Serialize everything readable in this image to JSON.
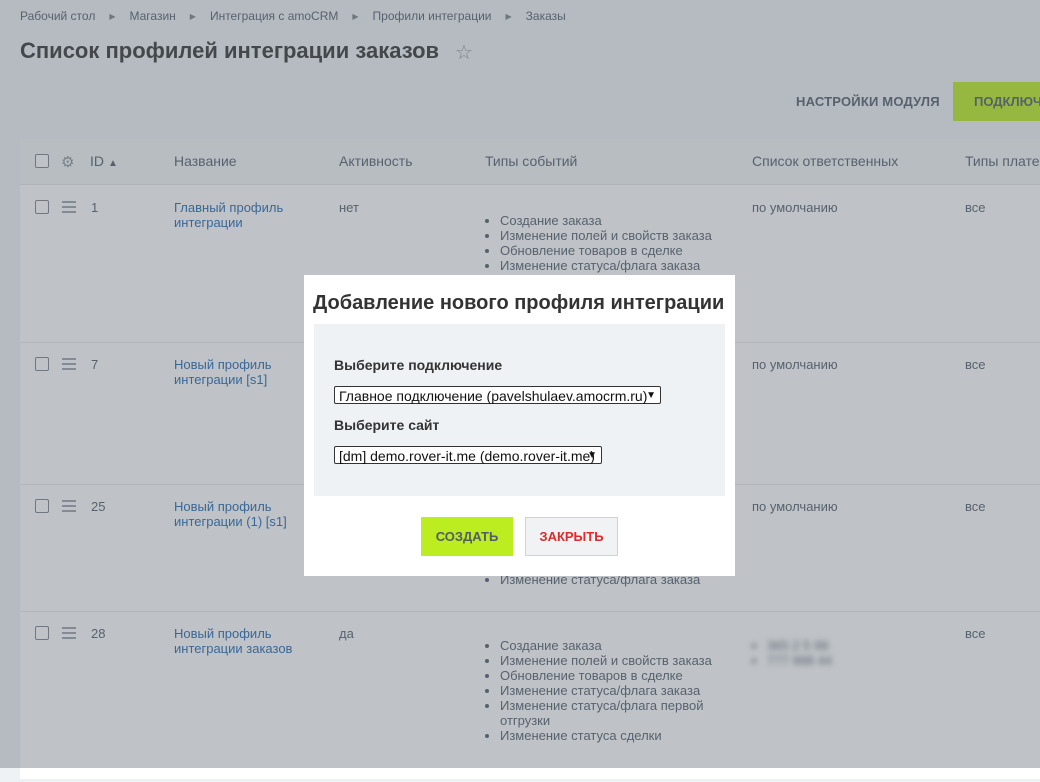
{
  "breadcrumb": [
    "Рабочий стол",
    "Магазин",
    "Интеграция с amoCRM",
    "Профили интеграции",
    "Заказы"
  ],
  "page_title": "Список профилей интеграции заказов",
  "toolbar": {
    "settings_label": "НАСТРОЙКИ МОДУЛЯ",
    "connect_label": "ПОДКЛЮЧ"
  },
  "columns": {
    "id": "ID",
    "name": "Название",
    "active": "Активность",
    "events": "Типы событий",
    "responsible": "Список ответственных",
    "payment": "Типы плате"
  },
  "rows": [
    {
      "id": "1",
      "name": "Главный профиль интеграции",
      "active": "нет",
      "events": [
        "Создание заказа",
        "Изменение полей и свойств заказа",
        "Обновление товаров в сделке",
        "Изменение статуса/флага заказа"
      ],
      "responsible": "по умолчанию",
      "payment": "все"
    },
    {
      "id": "7",
      "name": "Новый профиль интеграции [s1]",
      "active": "",
      "events": [],
      "responsible": "по умолчанию",
      "payment": "все"
    },
    {
      "id": "25",
      "name": "Новый профиль интеграции (1) [s1]",
      "active": "",
      "events": [
        "Изменение статуса/флага заказа"
      ],
      "responsible": "по умолчанию",
      "payment": "все"
    },
    {
      "id": "28",
      "name": "Новый профиль интеграции заказов",
      "active": "да",
      "events": [
        "Создание заказа",
        "Изменение полей и свойств заказа",
        "Обновление товаров в сделке",
        "Изменение статуса/флага заказа",
        "Изменение статуса/флага первой отгрузки",
        "Изменение статуса сделки"
      ],
      "responsible_blurred": [
        "365 2 5 99",
        "777 998 44"
      ],
      "payment": "все"
    }
  ],
  "modal": {
    "title": "Добавление нового профиля интеграции",
    "connection_label": "Выберите подключение",
    "connection_value": "Главное подключение (pavelshulaev.amocrm.ru)",
    "site_label": "Выберите сайт",
    "site_value": "[dm] demo.rover-it.me (demo.rover-it.me)",
    "create_label": "СОЗДАТЬ",
    "close_label": "ЗАКРЫТЬ"
  }
}
